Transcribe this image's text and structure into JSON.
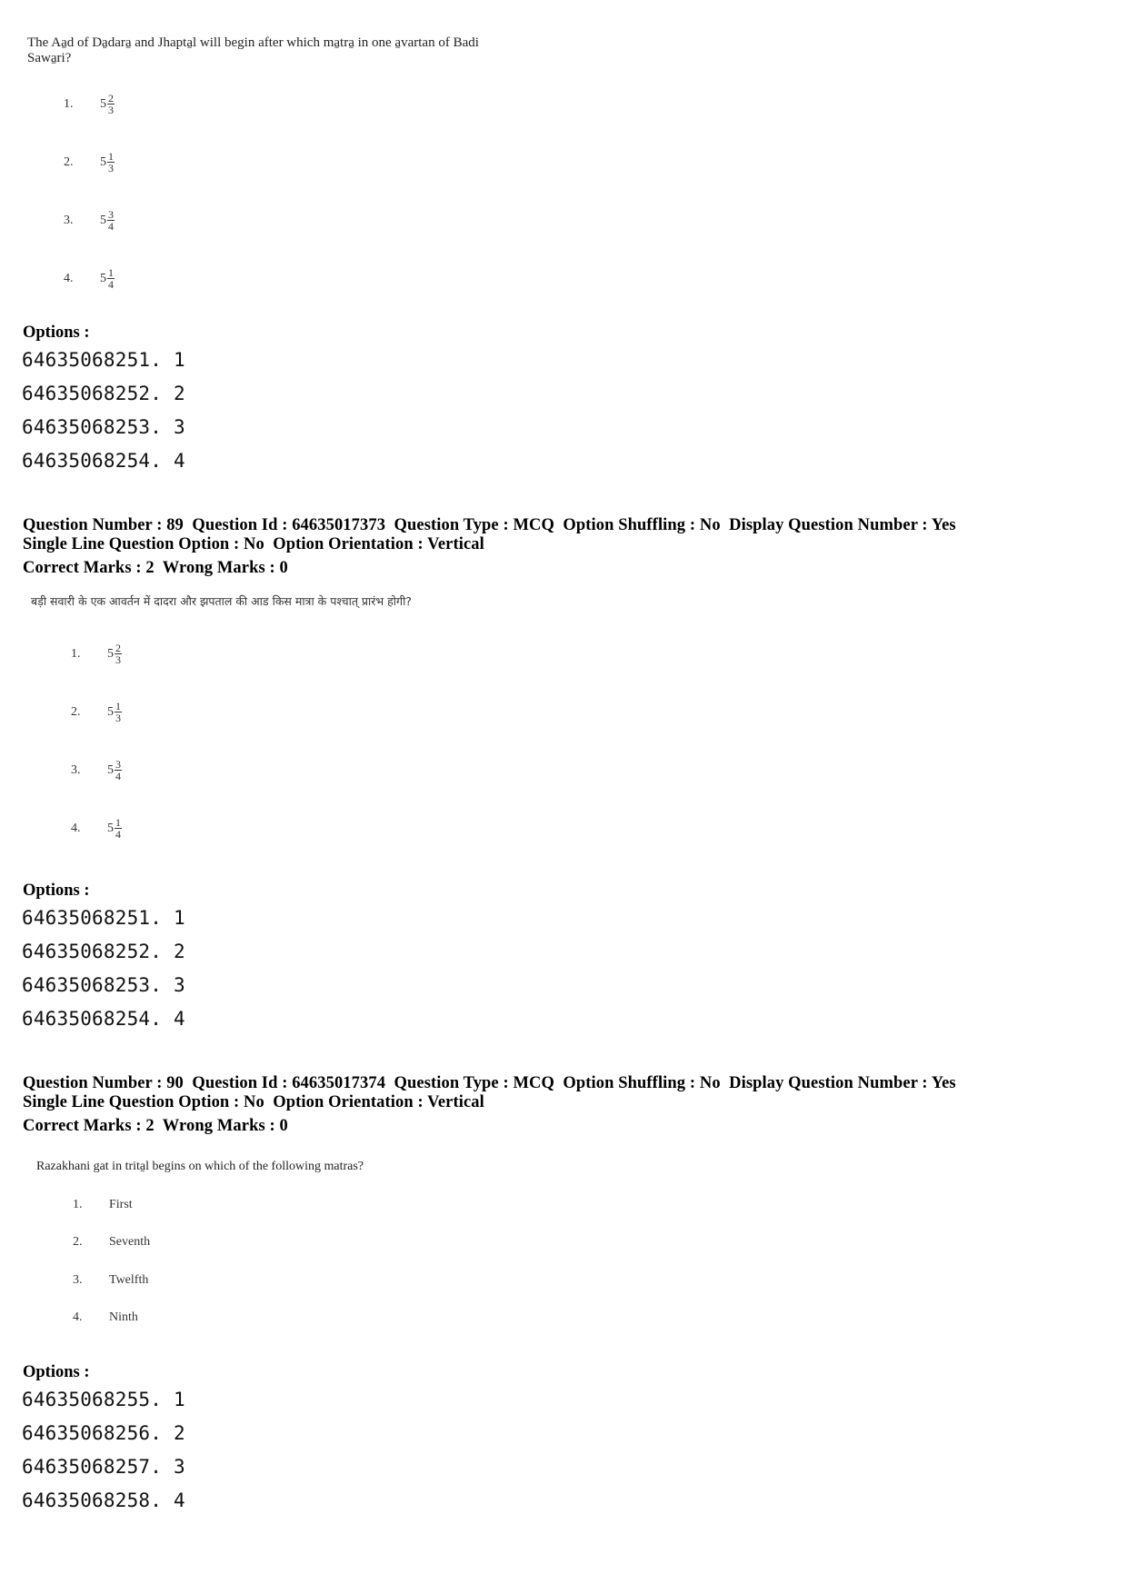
{
  "questions": [
    {
      "question_text": "The Aa̱d of Da̱dara̱ and Jhapta̱l will begin after which ma̱tra̱ in one a̱vartan of Badi Sawa̱ri?",
      "question_line1": "The Aa̱d of Da̱dara̱ and Jhapta̱l will begin after which ma̱tra̱ in one a̱vartan of Badi",
      "question_line2": "Sawa̱ri?",
      "choices": [
        {
          "num": "1.",
          "whole": "5",
          "numerator": "2",
          "denominator": "3"
        },
        {
          "num": "2.",
          "whole": "5",
          "numerator": "1",
          "denominator": "3"
        },
        {
          "num": "3.",
          "whole": "5",
          "numerator": "3",
          "denominator": "4"
        },
        {
          "num": "4.",
          "whole": "5",
          "numerator": "1",
          "denominator": "4"
        }
      ],
      "options_label": "Options :",
      "options": [
        "64635068251. 1",
        "64635068252. 2",
        "64635068253. 3",
        "64635068254. 4"
      ]
    },
    {
      "meta_line1": "Question Number : 89  Question Id : 64635017373  Question Type : MCQ  Option Shuffling : No  Display Question Number : Yes",
      "meta_line2": "Single Line Question Option : No  Option Orientation : Vertical",
      "marks_line": "Correct Marks : 2  Wrong Marks : 0",
      "question_text": "बड़ी सवारी के एक आवर्तन में दादरा और झपताल की आड किस मात्रा के पश्चात् प्रारंभ होगी?",
      "choices": [
        {
          "num": "1.",
          "whole": "5",
          "numerator": "2",
          "denominator": "3"
        },
        {
          "num": "2.",
          "whole": "5",
          "numerator": "1",
          "denominator": "3"
        },
        {
          "num": "3.",
          "whole": "5",
          "numerator": "3",
          "denominator": "4"
        },
        {
          "num": "4.",
          "whole": "5",
          "numerator": "1",
          "denominator": "4"
        }
      ],
      "options_label": "Options :",
      "options": [
        "64635068251. 1",
        "64635068252. 2",
        "64635068253. 3",
        "64635068254. 4"
      ]
    },
    {
      "meta_line1": "Question Number : 90  Question Id : 64635017374  Question Type : MCQ  Option Shuffling : No  Display Question Number : Yes",
      "meta_line2": "Single Line Question Option : No  Option Orientation : Vertical",
      "marks_line": "Correct Marks : 2  Wrong Marks : 0",
      "question_text": "Razakhani gat in trita̱l begins on which of the following matras?",
      "choices": [
        {
          "num": "1.",
          "text": "First"
        },
        {
          "num": "2.",
          "text": "Seventh"
        },
        {
          "num": "3.",
          "text": "Twelfth"
        },
        {
          "num": "4.",
          "text": "Ninth"
        }
      ],
      "options_label": "Options :",
      "options": [
        "64635068255. 1",
        "64635068256. 2",
        "64635068257. 3",
        "64635068258. 4"
      ]
    }
  ]
}
